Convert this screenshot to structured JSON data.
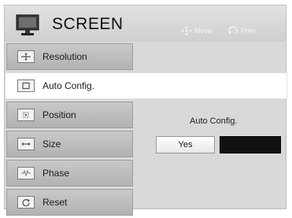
{
  "header": {
    "title": "SCREEN",
    "hints": [
      {
        "icon": "directional-pad-icon",
        "label": "Move"
      },
      {
        "icon": "return-arrow-icon",
        "label": "Prev."
      }
    ]
  },
  "menu": {
    "items": [
      {
        "label": "Resolution",
        "icon": "resolution-icon",
        "active": false
      },
      {
        "label": "Auto Config.",
        "icon": "auto-config-icon",
        "active": true
      },
      {
        "label": "Position",
        "icon": "position-icon",
        "active": false
      },
      {
        "label": "Size",
        "icon": "size-icon",
        "active": false
      },
      {
        "label": "Phase",
        "icon": "phase-icon",
        "active": false
      },
      {
        "label": "Reset",
        "icon": "reset-icon",
        "active": false
      }
    ]
  },
  "content": {
    "title": "Auto Config.",
    "yes_label": "Yes",
    "no_label": ""
  },
  "colors": {
    "panel": "#d9d9d9",
    "active": "#ffffff",
    "selected_button": "#111111"
  }
}
